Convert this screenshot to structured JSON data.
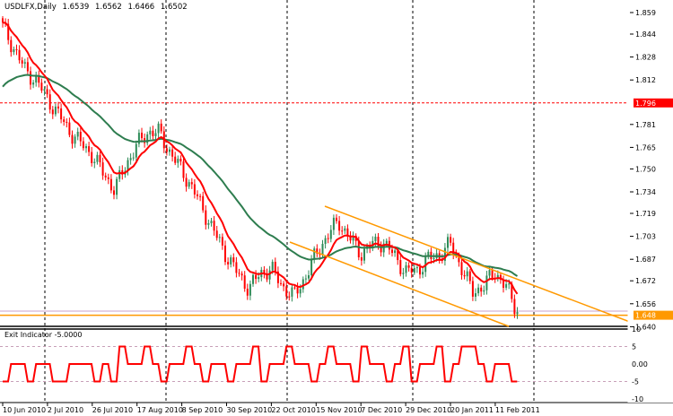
{
  "header": {
    "symbol": "USDLFX,Daily",
    "open": "1.6539",
    "high": "1.6562",
    "low": "1.6466",
    "close": "1.6502"
  },
  "indicator": {
    "label": "Exit Indicator -5.0000"
  },
  "colors": {
    "bull": "#2e8b57",
    "bear": "#ff0000",
    "fast_ma": "#ff0000",
    "slow_ma": "#2e7d4f",
    "channel": "#ff9900",
    "alert_line": "#ff0000",
    "current_price": "#ff9900"
  },
  "chart_data": [
    {
      "type": "candlestick",
      "title": "USDLFX,Daily",
      "grid": false,
      "x_tick_labels": [
        "10 Jun 2010",
        "2 Jul 2010",
        "26 Jul 2010",
        "17 Aug 2010",
        "8 Sep 2010",
        "30 Sep 2010",
        "22 Oct 2010",
        "15 Nov 2010",
        "7 Dec 2010",
        "29 Dec 2010",
        "20 Jan 2011",
        "11 Feb 2011"
      ],
      "y_tick_labels": [
        "1.859",
        "1.844",
        "1.828",
        "1.812",
        "1.781",
        "1.765",
        "1.750",
        "1.734",
        "1.719",
        "1.703",
        "1.687",
        "1.672",
        "1.656",
        "1.640"
      ],
      "ylim": [
        1.639,
        1.864
      ],
      "close_samples": [
        1.849,
        1.834,
        1.819,
        1.8115,
        1.799,
        1.7878,
        1.7759,
        1.7678,
        1.7596,
        1.7471,
        1.7353,
        1.7528,
        1.7665,
        1.7759,
        1.7753,
        1.7609,
        1.749,
        1.7359,
        1.7203,
        1.7046,
        1.6896,
        1.6771,
        1.6665,
        1.6771,
        1.6803,
        1.6684,
        1.6609,
        1.674,
        1.6903,
        1.7034,
        1.7134,
        1.7021,
        1.6909,
        1.6971,
        1.699,
        1.6896,
        1.6784,
        1.679,
        1.6871,
        1.6896,
        1.6978,
        1.6815,
        1.664,
        1.6684,
        1.6784,
        1.6678,
        1.6502
      ],
      "alert_level": {
        "value": 1.796,
        "label": "1.796"
      },
      "current_price": {
        "value": 1.648,
        "label": "1.648"
      },
      "moving_averages": [
        {
          "role": "fast",
          "color": "#ff0000"
        },
        {
          "role": "slow",
          "color": "#2e7d4f"
        }
      ],
      "channel": {
        "upper": [
          [
            1.719,
            "2010-11-15"
          ],
          [
            1.64,
            "beyond 2011-02"
          ]
        ],
        "lower": [
          [
            1.694,
            "2010-11-01"
          ],
          [
            1.64,
            "2011-02-03"
          ]
        ]
      }
    },
    {
      "type": "line",
      "title": "Exit Indicator -5.0000",
      "y_tick_labels": [
        "10",
        "5",
        "0.00",
        "-5",
        "-10"
      ],
      "ylim": [
        -10,
        10
      ],
      "values": [
        -5,
        0,
        0,
        -5,
        0,
        0,
        -5,
        -5,
        0,
        0,
        0,
        -5,
        0,
        -5,
        5,
        0,
        0,
        5,
        0,
        -5,
        0,
        0,
        5,
        0,
        -5,
        0,
        0,
        -5,
        0,
        0,
        5,
        -5,
        0,
        0,
        5,
        0,
        0,
        -5,
        0,
        5,
        0,
        0,
        -5,
        5,
        0,
        0,
        -5,
        0,
        5,
        -5,
        0,
        0,
        5,
        -5,
        0,
        5,
        5,
        0,
        -5,
        0,
        0,
        -5
      ]
    }
  ]
}
